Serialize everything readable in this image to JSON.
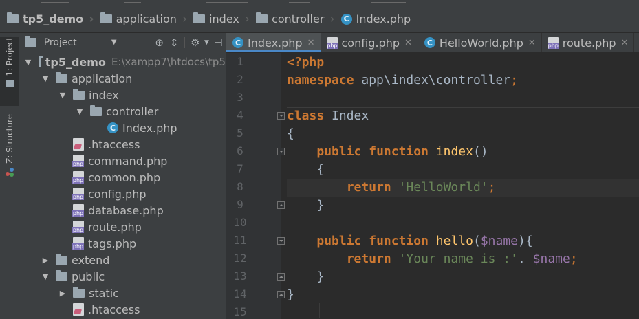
{
  "breadcrumb": [
    {
      "label": "tp5_demo",
      "icon": "folder-icon"
    },
    {
      "label": "application",
      "icon": "folder-icon"
    },
    {
      "label": "index",
      "icon": "folder-icon"
    },
    {
      "label": "controller",
      "icon": "folder-icon"
    },
    {
      "label": "Index.php",
      "icon": "php-class-icon"
    }
  ],
  "sidebar": {
    "project_tab": "1: Project",
    "structure_tab": "Z: Structure"
  },
  "project_panel": {
    "view_label": "Project",
    "toolbar_icons": [
      "locate-icon",
      "collapse-icon",
      "settings-icon",
      "hide-icon"
    ],
    "tree": [
      {
        "label": "tp5_demo",
        "path": "E:\\xampp7\\htdocs\\tp5",
        "depth": 0,
        "expanded": true,
        "type": "folder"
      },
      {
        "label": "application",
        "depth": 1,
        "expanded": true,
        "type": "folder"
      },
      {
        "label": "index",
        "depth": 2,
        "expanded": true,
        "type": "folder"
      },
      {
        "label": "controller",
        "depth": 3,
        "expanded": true,
        "type": "folder"
      },
      {
        "label": "Index.php",
        "depth": 4,
        "type": "class"
      },
      {
        "label": ".htaccess",
        "depth": 2,
        "type": "htaccess"
      },
      {
        "label": "command.php",
        "depth": 2,
        "type": "php"
      },
      {
        "label": "common.php",
        "depth": 2,
        "type": "php"
      },
      {
        "label": "config.php",
        "depth": 2,
        "type": "php"
      },
      {
        "label": "database.php",
        "depth": 2,
        "type": "php"
      },
      {
        "label": "route.php",
        "depth": 2,
        "type": "php"
      },
      {
        "label": "tags.php",
        "depth": 2,
        "type": "php"
      },
      {
        "label": "extend",
        "depth": 1,
        "expanded": false,
        "type": "folder"
      },
      {
        "label": "public",
        "depth": 1,
        "expanded": true,
        "type": "folder"
      },
      {
        "label": "static",
        "depth": 2,
        "expanded": false,
        "type": "folder"
      },
      {
        "label": ".htaccess",
        "depth": 2,
        "type": "htaccess"
      }
    ]
  },
  "editor_tabs": [
    {
      "label": "Index.php",
      "icon": "php-class-icon",
      "active": true
    },
    {
      "label": "config.php",
      "icon": "php-file-icon",
      "active": false
    },
    {
      "label": "HelloWorld.php",
      "icon": "php-class-icon",
      "active": false
    },
    {
      "label": "route.php",
      "icon": "php-file-icon",
      "active": false
    }
  ],
  "editor": {
    "caret_line": 8,
    "line_numbers": [
      "1",
      "2",
      "3",
      "4",
      "5",
      "6",
      "7",
      "8",
      "9",
      "10",
      "11",
      "12",
      "13",
      "14",
      "15"
    ],
    "lines": [
      [
        {
          "t": "<?php",
          "c": "kw"
        }
      ],
      [
        {
          "t": "namespace",
          "c": "kw"
        },
        {
          "t": " app\\index\\controller",
          "c": ""
        },
        {
          "t": ";",
          "c": "pu"
        }
      ],
      [],
      [
        {
          "t": "class",
          "c": "kw"
        },
        {
          "t": " Index",
          "c": ""
        }
      ],
      [
        {
          "t": "{",
          "c": ""
        }
      ],
      [
        {
          "t": "    ",
          "c": ""
        },
        {
          "t": "public",
          "c": "kw"
        },
        {
          "t": " ",
          "c": ""
        },
        {
          "t": "function",
          "c": "kw"
        },
        {
          "t": " ",
          "c": ""
        },
        {
          "t": "index",
          "c": "fn"
        },
        {
          "t": "()",
          "c": ""
        }
      ],
      [
        {
          "t": "    {",
          "c": ""
        }
      ],
      [
        {
          "t": "        ",
          "c": ""
        },
        {
          "t": "return",
          "c": "kw"
        },
        {
          "t": " ",
          "c": ""
        },
        {
          "t": "'HelloWorld'",
          "c": "st"
        },
        {
          "t": ";",
          "c": "pu"
        }
      ],
      [
        {
          "t": "    }",
          "c": ""
        }
      ],
      [],
      [
        {
          "t": "    ",
          "c": ""
        },
        {
          "t": "public",
          "c": "kw"
        },
        {
          "t": " ",
          "c": ""
        },
        {
          "t": "function",
          "c": "kw"
        },
        {
          "t": " ",
          "c": ""
        },
        {
          "t": "hello",
          "c": "fn"
        },
        {
          "t": "(",
          "c": ""
        },
        {
          "t": "$name",
          "c": "vr"
        },
        {
          "t": "){",
          "c": ""
        }
      ],
      [
        {
          "t": "        ",
          "c": ""
        },
        {
          "t": "return",
          "c": "kw"
        },
        {
          "t": " ",
          "c": ""
        },
        {
          "t": "'Your name is :'",
          "c": "st"
        },
        {
          "t": ". ",
          "c": ""
        },
        {
          "t": "$name",
          "c": "vr"
        },
        {
          "t": ";",
          "c": "pu"
        }
      ],
      [
        {
          "t": "    }",
          "c": ""
        }
      ],
      [
        {
          "t": "}",
          "c": ""
        }
      ],
      []
    ]
  },
  "colors": {
    "keyword": "#cc7832",
    "string": "#6a8759",
    "function": "#ffc66d",
    "variable": "#9876aa",
    "default": "#a9b7c6",
    "panel": "#3c3f41",
    "editor_bg": "#2b2b2b",
    "active_tab_underline": "#4a88c7"
  }
}
